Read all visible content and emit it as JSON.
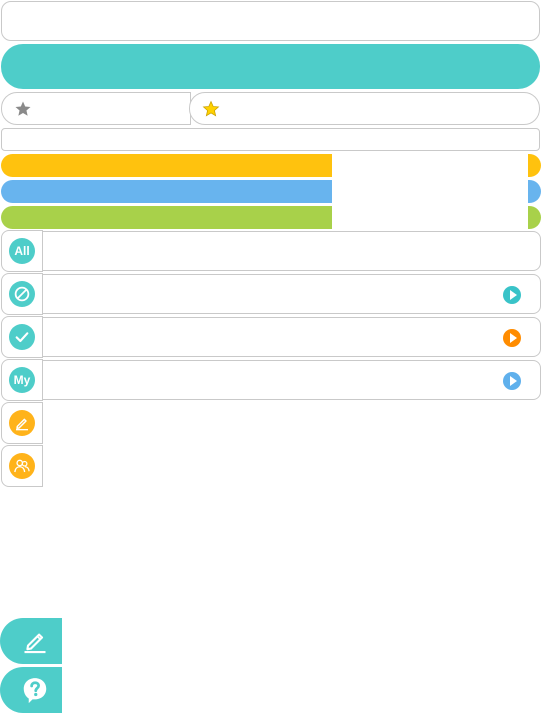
{
  "icons": {
    "all": "all-filter-icon",
    "blocked": "prohibited-icon",
    "checked": "checkmark-icon",
    "my": "my-filter-icon",
    "edit": "pencil-edit-icon",
    "group": "users-group-icon",
    "side_edit": "pencil-icon",
    "side_help": "question-bubble-icon"
  },
  "filters": {
    "all_label": "All",
    "my_label": "My"
  },
  "colors": {
    "teal": "#4ecdc9",
    "yellow": "#ffc20e",
    "blue": "#68b4ee",
    "green": "#a8d14a",
    "orange": "#ffb31a"
  }
}
